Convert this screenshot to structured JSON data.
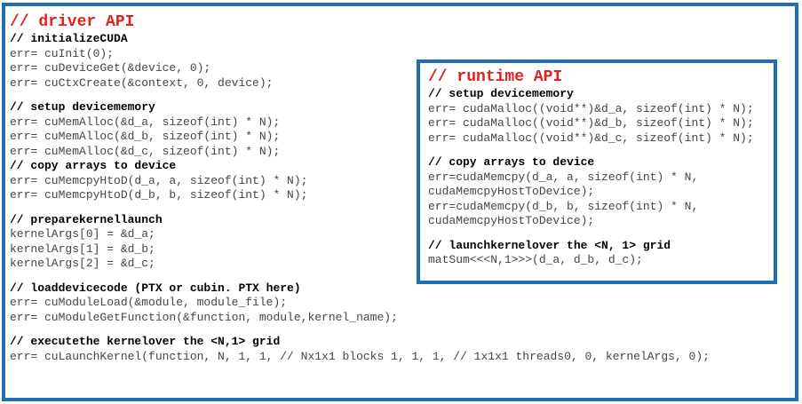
{
  "driver": {
    "title": "// driver API",
    "lines": [
      {
        "text": "// initializeCUDA",
        "kind": "comment"
      },
      {
        "text": "err= cuInit(0);",
        "kind": "code"
      },
      {
        "text": "err= cuDeviceGet(&device, 0);",
        "kind": "code"
      },
      {
        "text": "err= cuCtxCreate(&context, 0, device);",
        "kind": "code"
      },
      {
        "text": "",
        "kind": "gap"
      },
      {
        "text": "// setup devicememory",
        "kind": "comment"
      },
      {
        "text": "err= cuMemAlloc(&d_a, sizeof(int) * N);",
        "kind": "code"
      },
      {
        "text": "err= cuMemAlloc(&d_b, sizeof(int) * N);",
        "kind": "code"
      },
      {
        "text": "err= cuMemAlloc(&d_c, sizeof(int) * N);",
        "kind": "code"
      },
      {
        "text": "// copy arrays to device",
        "kind": "comment"
      },
      {
        "text": "err= cuMemcpyHtoD(d_a, a, sizeof(int) * N);",
        "kind": "code"
      },
      {
        "text": "err= cuMemcpyHtoD(d_b, b, sizeof(int) * N);",
        "kind": "code"
      },
      {
        "text": "",
        "kind": "gap"
      },
      {
        "text": "// preparekernellaunch",
        "kind": "comment"
      },
      {
        "text": "kernelArgs[0] = &d_a;",
        "kind": "code"
      },
      {
        "text": "kernelArgs[1] = &d_b;",
        "kind": "code"
      },
      {
        "text": "kernelArgs[2] = &d_c;",
        "kind": "code"
      },
      {
        "text": "",
        "kind": "gap"
      },
      {
        "text": "// loaddevicecode (PTX or cubin. PTX here)",
        "kind": "comment"
      },
      {
        "text": "err= cuModuleLoad(&module, module_file);",
        "kind": "code"
      },
      {
        "text": "err= cuModuleGetFunction(&function, module,kernel_name);",
        "kind": "code"
      },
      {
        "text": "",
        "kind": "gap"
      },
      {
        "text": "// executethe kernelover the <N,1> grid",
        "kind": "comment"
      },
      {
        "text": "err= cuLaunchKernel(function, N, 1, 1, // Nx1x1 blocks 1, 1, 1, // 1x1x1 threads0, 0, kernelArgs, 0);",
        "kind": "code"
      }
    ]
  },
  "runtime": {
    "title": "// runtime API",
    "lines": [
      {
        "text": "// setup devicememory",
        "kind": "comment"
      },
      {
        "text": "err= cudaMalloc((void**)&d_a, sizeof(int) * N);",
        "kind": "code"
      },
      {
        "text": "err= cudaMalloc((void**)&d_b, sizeof(int) * N);",
        "kind": "code"
      },
      {
        "text": "err= cudaMalloc((void**)&d_c, sizeof(int) * N);",
        "kind": "code"
      },
      {
        "text": "",
        "kind": "gap"
      },
      {
        "text": "// copy arrays to device",
        "kind": "comment"
      },
      {
        "text": "err=cudaMemcpy(d_a, a, sizeof(int) * N,",
        "kind": "code"
      },
      {
        "text": "cudaMemcpyHostToDevice);",
        "kind": "code"
      },
      {
        "text": "err=cudaMemcpy(d_b, b, sizeof(int) * N,",
        "kind": "code"
      },
      {
        "text": "cudaMemcpyHostToDevice);",
        "kind": "code"
      },
      {
        "text": "",
        "kind": "gap"
      },
      {
        "text": "// launchkernelover the <N, 1> grid",
        "kind": "comment"
      },
      {
        "text": "matSum<<<N,1>>>(d_a, d_b, d_c);",
        "kind": "code"
      }
    ]
  },
  "colors": {
    "border": "#1f6db5",
    "title": "#e0201b",
    "code": "#454545",
    "comment": "#000000"
  }
}
